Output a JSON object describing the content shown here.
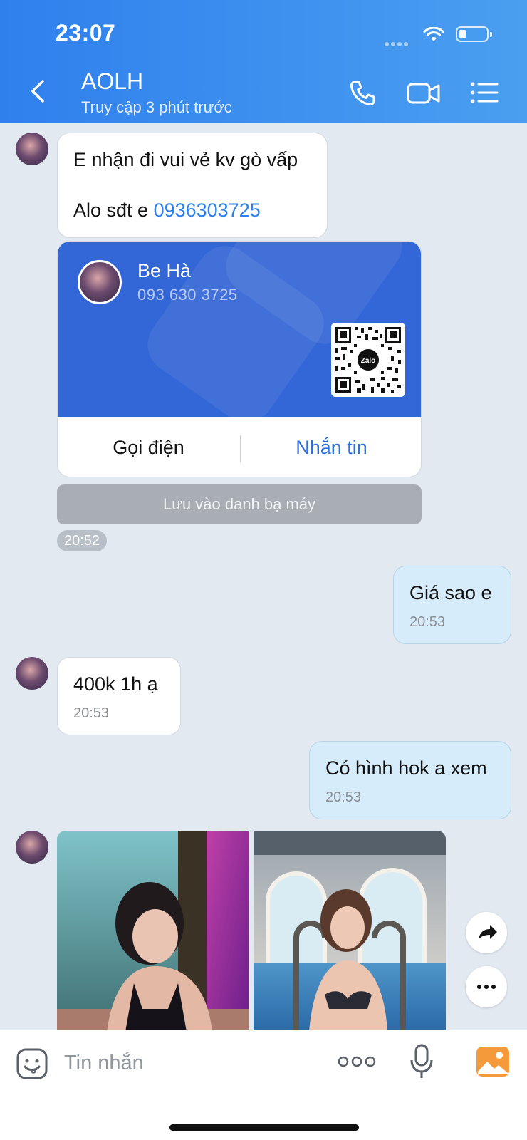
{
  "status_bar": {
    "time": "23:07"
  },
  "header": {
    "title": "AOLH",
    "subtitle": "Truy cập 3 phút trước"
  },
  "messages": {
    "m1_line1": "E nhận đi vui vẻ kv gò vấp",
    "m1_line2_prefix": "Alo sđt e ",
    "m1_phone_link": "0936303725",
    "card": {
      "name": "Be Hà",
      "phone": "093 630 3725",
      "call_label": "Gọi điện",
      "message_label": "Nhắn tin",
      "qr_brand": "Zalo"
    },
    "save_contact": "Lưu vào danh bạ máy",
    "card_time": "20:52",
    "me1_text": "Giá sao e",
    "me1_time": "20:53",
    "them2_text": "400k 1h ạ",
    "them2_time": "20:53",
    "me2_text": "Có hình hok a xem",
    "me2_time": "20:53"
  },
  "input": {
    "placeholder": "Tin nhắn"
  },
  "icons": {
    "back": "chevron-left-icon",
    "call": "phone-icon",
    "video": "video-icon",
    "menu": "list-icon",
    "share": "share-icon",
    "more": "more-icon",
    "sticker": "sticker-icon",
    "mic": "mic-icon",
    "gallery": "image-icon"
  },
  "colors": {
    "header_start": "#2f80ed",
    "header_end": "#4a9ff0",
    "card_blue": "#3366d6",
    "link_blue": "#2f80ed",
    "my_bubble": "#d6ecfa",
    "background": "#e2e9f1"
  }
}
